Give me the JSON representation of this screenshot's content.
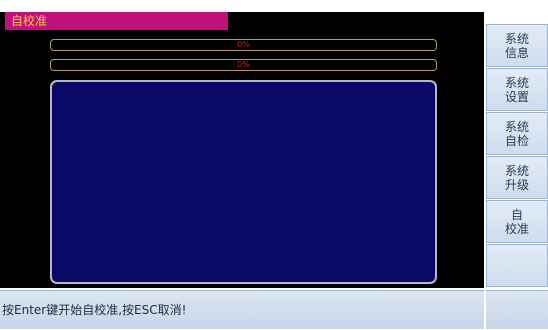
{
  "window": {
    "title": "自校准"
  },
  "progress": [
    {
      "value_text": "0%",
      "fraction": 0.0
    },
    {
      "value_text": "0%",
      "fraction": 0.0
    }
  ],
  "sidebar": {
    "items": [
      {
        "label": "系统\n信息"
      },
      {
        "label": "系统\n设置"
      },
      {
        "label": "系统\n自检"
      },
      {
        "label": "系统\n升级"
      },
      {
        "label": "自\n校准"
      },
      {
        "label": ""
      }
    ]
  },
  "status": {
    "message": "按Enter键开始自校准,按ESC取消!"
  },
  "colors": {
    "title_bg": "#c0107a",
    "title_text": "#ffcf3a",
    "panel_bg": "#0a0a66",
    "progress_text": "#d02020"
  }
}
